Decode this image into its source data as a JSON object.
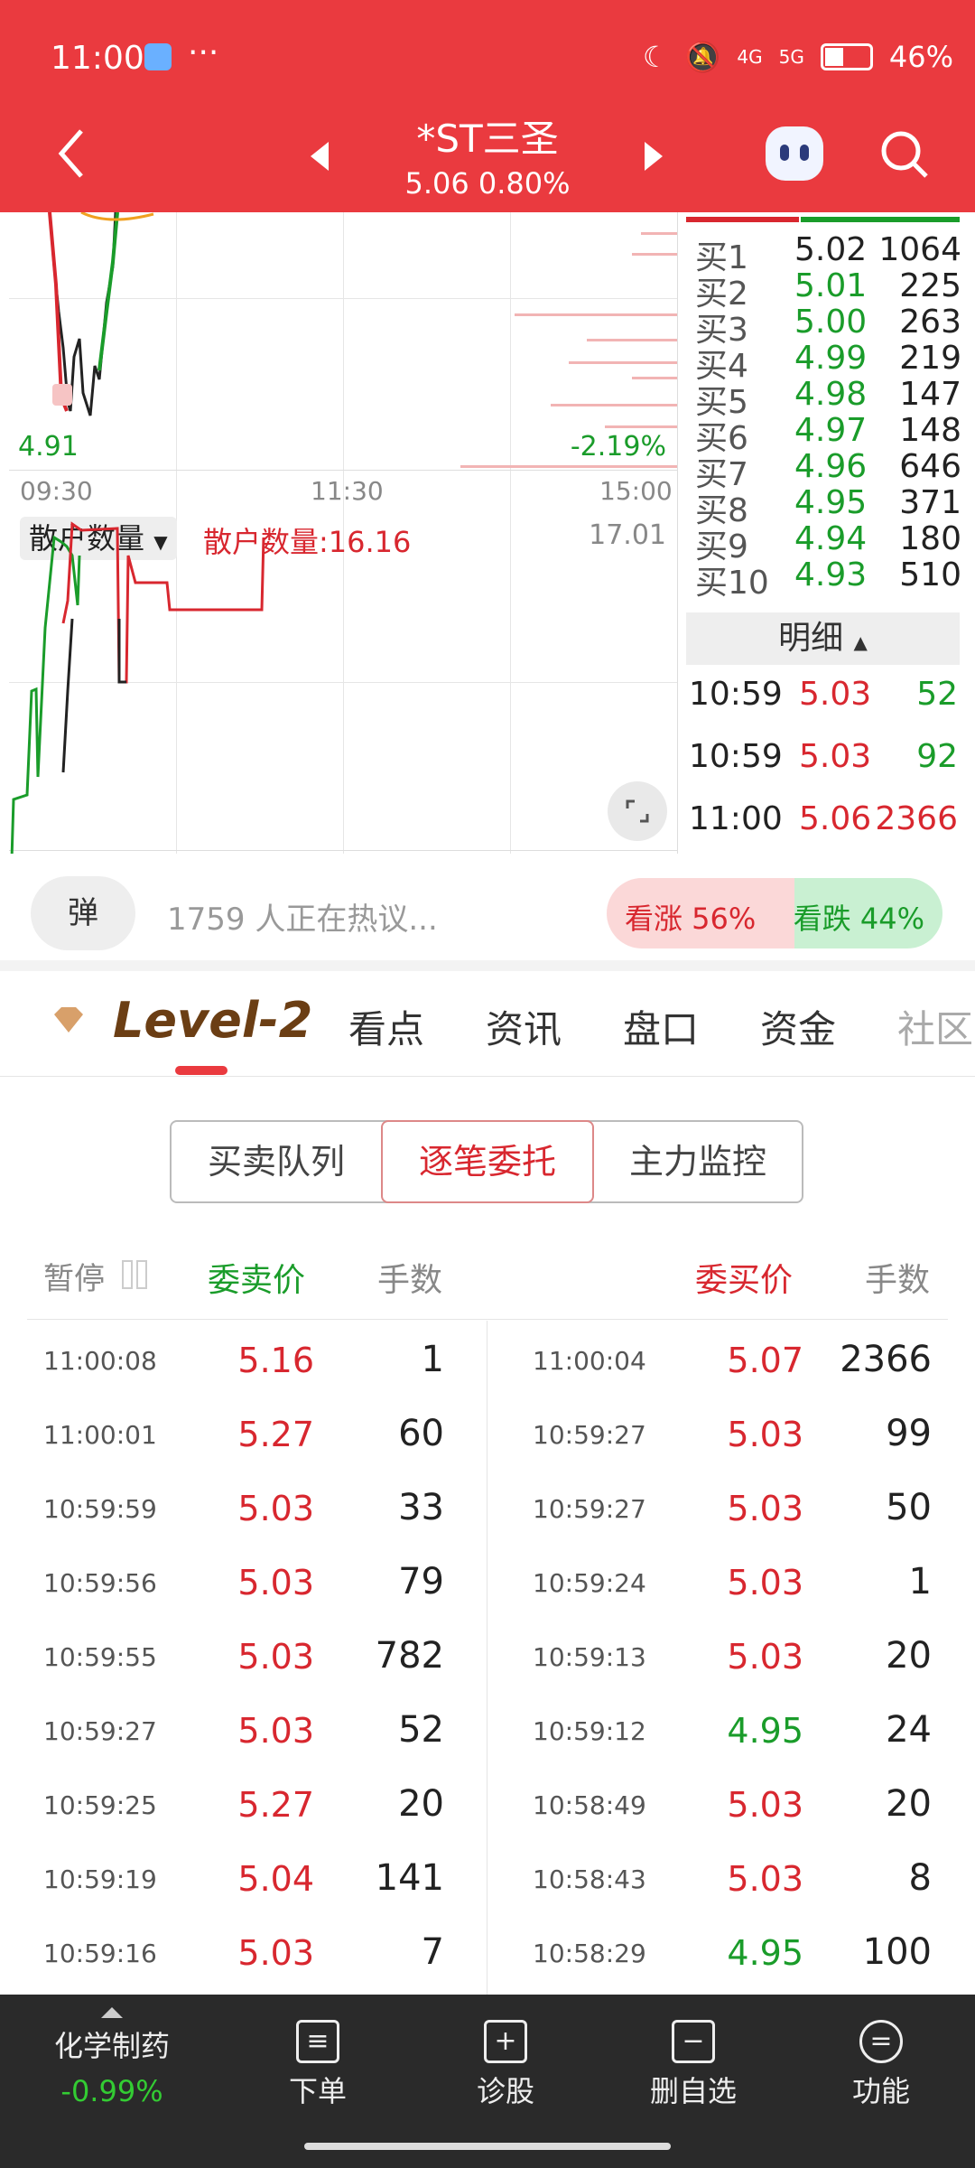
{
  "status": {
    "time": "11:00",
    "net1": "4G",
    "net2": "5G",
    "battery": "46%"
  },
  "header": {
    "title": "*ST三圣",
    "subtitle": "5.06 0.80%"
  },
  "chart": {
    "low_price": "4.91",
    "low_pct": "-2.19%",
    "times": [
      "09:30",
      "11:30",
      "15:00"
    ],
    "indicator_label": "散户数量",
    "indicator_value_text": "散户数量:16.16",
    "indicator_max": "17.01"
  },
  "order_book": [
    {
      "label": "买1",
      "price": "5.02",
      "vol": "1064"
    },
    {
      "label": "买2",
      "price": "5.01",
      "vol": "225"
    },
    {
      "label": "买3",
      "price": "5.00",
      "vol": "263"
    },
    {
      "label": "买4",
      "price": "4.99",
      "vol": "219"
    },
    {
      "label": "买5",
      "price": "4.98",
      "vol": "147"
    },
    {
      "label": "买6",
      "price": "4.97",
      "vol": "148"
    },
    {
      "label": "买7",
      "price": "4.96",
      "vol": "646"
    },
    {
      "label": "买8",
      "price": "4.95",
      "vol": "371"
    },
    {
      "label": "买9",
      "price": "4.94",
      "vol": "180"
    },
    {
      "label": "买10",
      "price": "4.93",
      "vol": "510"
    }
  ],
  "detail": {
    "title": "明细",
    "rows": [
      {
        "time": "10:59",
        "price": "5.03",
        "vol": "52"
      },
      {
        "time": "10:59",
        "price": "5.03",
        "vol": "92"
      },
      {
        "time": "11:00",
        "price": "5.06",
        "vol": "2366"
      }
    ]
  },
  "discussion": {
    "danmu": "弹",
    "text": "1759 人正在热议...",
    "bull": "看涨 56%",
    "bear": "看跌 44%",
    "bull_fraction": 0.56
  },
  "tabs": [
    "Level-2",
    "看点",
    "资讯",
    "盘口",
    "资金",
    "社区"
  ],
  "segments": [
    "买卖队列",
    "逐笔委托",
    "主力监控"
  ],
  "table": {
    "pause": "暂停",
    "sell_header": "委卖价",
    "vol_header": "手数",
    "buy_header": "委买价",
    "sell": [
      {
        "time": "11:00:08",
        "price": "5.16",
        "vol": "1"
      },
      {
        "time": "11:00:01",
        "price": "5.27",
        "vol": "60"
      },
      {
        "time": "10:59:59",
        "price": "5.03",
        "vol": "33"
      },
      {
        "time": "10:59:56",
        "price": "5.03",
        "vol": "79"
      },
      {
        "time": "10:59:55",
        "price": "5.03",
        "vol": "782"
      },
      {
        "time": "10:59:27",
        "price": "5.03",
        "vol": "52"
      },
      {
        "time": "10:59:25",
        "price": "5.27",
        "vol": "20"
      },
      {
        "time": "10:59:19",
        "price": "5.04",
        "vol": "141"
      },
      {
        "time": "10:59:16",
        "price": "5.03",
        "vol": "7"
      }
    ],
    "buy": [
      {
        "time": "11:00:04",
        "price": "5.07",
        "vol": "2366",
        "color": "red"
      },
      {
        "time": "10:59:27",
        "price": "5.03",
        "vol": "99",
        "color": "red"
      },
      {
        "time": "10:59:27",
        "price": "5.03",
        "vol": "50",
        "color": "red"
      },
      {
        "time": "10:59:24",
        "price": "5.03",
        "vol": "1",
        "color": "red"
      },
      {
        "time": "10:59:13",
        "price": "5.03",
        "vol": "20",
        "color": "red"
      },
      {
        "time": "10:59:12",
        "price": "4.95",
        "vol": "24",
        "color": "green"
      },
      {
        "time": "10:58:49",
        "price": "5.03",
        "vol": "20",
        "color": "red"
      },
      {
        "time": "10:58:43",
        "price": "5.03",
        "vol": "8",
        "color": "red"
      },
      {
        "time": "10:58:29",
        "price": "4.95",
        "vol": "100",
        "color": "green"
      }
    ]
  },
  "bottom": {
    "sector": "化学制药",
    "sector_pct": "-0.99%",
    "items": [
      "下单",
      "诊股",
      "删自选",
      "功能"
    ]
  },
  "colors": {
    "brand": "#ea3a3f",
    "up": "#d8272f",
    "down": "#1a9c2a"
  }
}
